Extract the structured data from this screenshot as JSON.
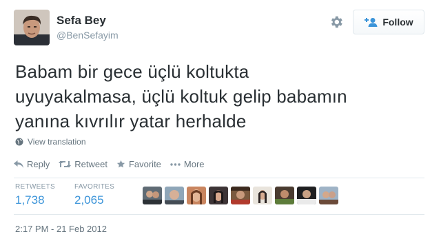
{
  "user": {
    "name": "Sefa Bey",
    "handle": "@BenSefayim"
  },
  "header": {
    "follow_label": "Follow"
  },
  "tweet": {
    "lines": [
      "Babam bir gece üçlü koltukta",
      "uyuyakalmasa, üçlü koltuk gelip babamın",
      "yanına kıvrılır yatar herhalde"
    ]
  },
  "translation": {
    "label": "View translation"
  },
  "actions": {
    "reply": "Reply",
    "retweet": "Retweet",
    "favorite": "Favorite",
    "more": "More"
  },
  "stats": {
    "retweets_label": "RETWEETS",
    "retweets_value": "1,738",
    "favorites_label": "FAVORITES",
    "favorites_value": "2,065"
  },
  "timestamp": "2:17 PM - 21 Feb 2012",
  "colors": {
    "link": "#3b94d9",
    "muted": "#8899a6",
    "text": "#292f33",
    "border": "#e1e8ed"
  }
}
